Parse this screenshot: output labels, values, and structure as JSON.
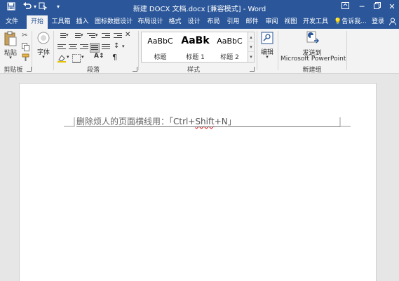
{
  "titlebar": {
    "title": "新建 DOCX 文档.docx [兼容模式] - Word",
    "qat": [
      {
        "icon": "save-icon",
        "glyph": "💾"
      },
      {
        "icon": "undo-icon",
        "glyph": "↶"
      },
      {
        "icon": "undo-dropdown-icon",
        "glyph": "▾"
      },
      {
        "icon": "touch-mode-icon",
        "glyph": "☜"
      },
      {
        "icon": "customize-qat-icon",
        "glyph": "▾"
      }
    ],
    "window_controls": [
      "ribbon-display-icon",
      "minimize-icon",
      "restore-icon",
      "close-icon"
    ]
  },
  "tabs": [
    {
      "label": "文件",
      "active": false
    },
    {
      "label": "开始",
      "active": true
    },
    {
      "label": "工具箱",
      "active": false
    },
    {
      "label": "插入",
      "active": false
    },
    {
      "label": "图标数据设计",
      "active": false
    },
    {
      "label": "布局设计",
      "active": false
    },
    {
      "label": "格式",
      "active": false
    },
    {
      "label": "设计",
      "active": false
    },
    {
      "label": "布局",
      "active": false
    },
    {
      "label": "引用",
      "active": false
    },
    {
      "label": "邮件",
      "active": false
    },
    {
      "label": "审阅",
      "active": false
    },
    {
      "label": "视图",
      "active": false
    },
    {
      "label": "开发工具",
      "active": false
    }
  ],
  "tell_me": "告诉我...",
  "login": "登录",
  "ribbon": {
    "clipboard": {
      "paste": "粘贴",
      "group": "剪贴板"
    },
    "font": {
      "label": "字体"
    },
    "paragraph": {
      "group": "段落"
    },
    "styles": {
      "group": "样式",
      "items": [
        {
          "sample": "AaBbC",
          "name": "标题"
        },
        {
          "sample": "AaBk",
          "name": "标题 1"
        },
        {
          "sample": "AaBbC",
          "name": "标题 2"
        }
      ]
    },
    "editing": {
      "label": "编辑"
    },
    "new_group": {
      "send_line1": "发送到",
      "send_line2": "Microsoft PowerPoint",
      "group": "新建组"
    }
  },
  "document": {
    "text_main": "删除烦人的页面横线用：",
    "bracket_open": "「",
    "keys_a": "Ctrl+",
    "keys_b": "Shift",
    "keys_c": "+N",
    "bracket_close": "」"
  },
  "colors": {
    "brand": "#2b579a",
    "ribbon_bg": "#f3f3f3",
    "canvas_bg": "#e6e6e6"
  }
}
